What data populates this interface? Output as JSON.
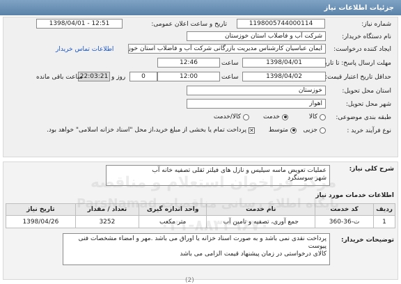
{
  "header": {
    "title": "جزئیات اطلاعات نیاز"
  },
  "need_number": {
    "label": "شماره نیاز:",
    "value": "1198005744000114"
  },
  "announce": {
    "label": "تاریخ و ساعت اعلان عمومی:",
    "value": "1398/04/01 - 12:51"
  },
  "buyer_org": {
    "label": "نام دستگاه خریدار:",
    "value": "شرکت آب و فاضلاب استان خوزستان"
  },
  "creator": {
    "label": "ایجاد کننده درخواست:",
    "value": "ایمان عباسیان کارشناس مدیریت بازرگانی شرکت آب و فاضلاب استان خوزستان",
    "contact_link": "اطلاعات تماس خریدار"
  },
  "send_deadline": {
    "label": "مهلت ارسال پاسخ: تا تاریخ:",
    "date": "1398/04/01",
    "time_label": "ساعت",
    "time": "12:46"
  },
  "price_deadline": {
    "label": "حداقل تاریخ اعتبار قیمت: تا تاریخ:",
    "date": "1398/04/02",
    "time_label": "ساعت",
    "time": "12:00",
    "days": "0",
    "days_label": "روز و",
    "remaining": "22:03:21",
    "remaining_label": "ساعت باقی مانده"
  },
  "province": {
    "label": "استان محل تحویل:",
    "value": "خوزستان"
  },
  "city": {
    "label": "شهر محل تحویل:",
    "value": "اهواز"
  },
  "category": {
    "label": "طبقه بندی موضوعی:",
    "options": [
      "کالا",
      "خدمت",
      "کالا/خدمت"
    ],
    "selected": "خدمت"
  },
  "purchase_type": {
    "label": "نوع فرآیند خرید :",
    "options": [
      "جزیی",
      "متوسط"
    ],
    "selected": "متوسط",
    "note": "پرداخت تمام یا بخشی از مبلغ خرید،از محل \"اسناد خزانه اسلامی\" خواهد بود."
  },
  "summary": {
    "label": "شرح کلی نیاز:",
    "line1": "عملیات تعویض ماسه سیلیس و نازل های فیلتر ثقلی تصفیه خانه آب",
    "line2": "شهر سوسنگرد"
  },
  "services": {
    "title": "اطلاعات خدمات مورد نیاز",
    "columns": [
      "ردیف",
      "کد خدمت",
      "نام خدمت",
      "واحد اندازه گیری",
      "تعداد / مقدار",
      "تاریخ نیاز"
    ],
    "rows": [
      [
        "1",
        "ت-36-360",
        "جمع آوری، تصفیه و تامین آب",
        "متر مکعب",
        "3252",
        "1398/04/26"
      ]
    ]
  },
  "buyer_notes": {
    "label": "توضیحات خریدار:",
    "line1": "پرداخت نقدی نمی باشد و به صورت اسناد خزانه یا اوراق می باشد .مهر و امضاء مشخصات فنی پیوست",
    "line2": "کالای درخواستی در زمان پیشنهاد قیمت الزامی می باشد"
  },
  "footer_partial": {
    "text": "(2)"
  },
  "watermark": {
    "line1": "مرکز فراخوان استعلام و مناقصه",
    "line2": "پایگاه اطلاع رسانی مناقصات ParsNamad",
    "line3": "۰۲۱-۸۸۳۴۹۶۷۰"
  }
}
